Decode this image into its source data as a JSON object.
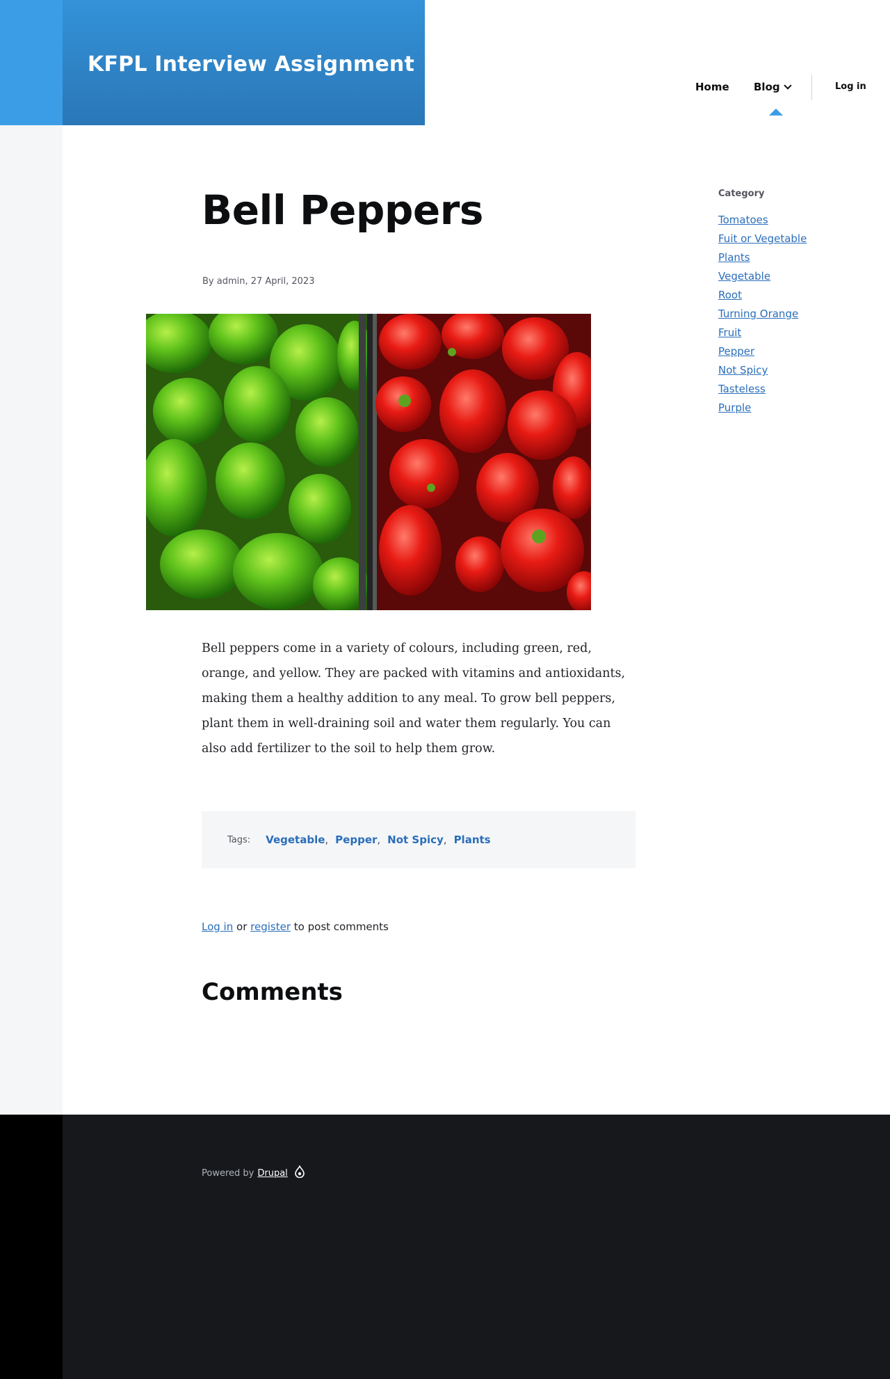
{
  "site": {
    "name": "KFPL Interview Assignment"
  },
  "nav": {
    "home": "Home",
    "blog": "Blog",
    "login": "Log in"
  },
  "article": {
    "title": "Bell Peppers",
    "meta": "By admin, 27 April, 2023",
    "image_alt": "Bell peppers",
    "body": "Bell peppers come in a variety of colours, including green, red, orange, and yellow. They are packed with vitamins and antioxidants, making them a healthy addition to any meal. To grow bell peppers, plant them in well-draining soil and water them regularly. You can also add fertilizer to the soil to help them grow."
  },
  "tags": {
    "label": "Tags:",
    "items": [
      "Vegetable",
      "Pepper",
      "Not Spicy",
      "Plants"
    ]
  },
  "comments": {
    "login_link": "Log in",
    "or_text": "or",
    "register_link": "register",
    "suffix": "to post comments",
    "heading": "Comments"
  },
  "sidebar": {
    "heading": "Category",
    "items": [
      "Tomatoes",
      "Fuit or Vegetable",
      "Plants",
      "Vegetable",
      "Root",
      "Turning Orange",
      "Fruit",
      "Pepper",
      "Not Spicy",
      "Tasteless",
      "Purple"
    ]
  },
  "footer": {
    "powered_by": "Powered by",
    "drupal": "Drupal"
  },
  "colors": {
    "brand_blue": "#2a77b7",
    "link_blue": "#2a6ebb",
    "accent_blue": "#3a9de6",
    "footer_bg": "#16181b"
  }
}
